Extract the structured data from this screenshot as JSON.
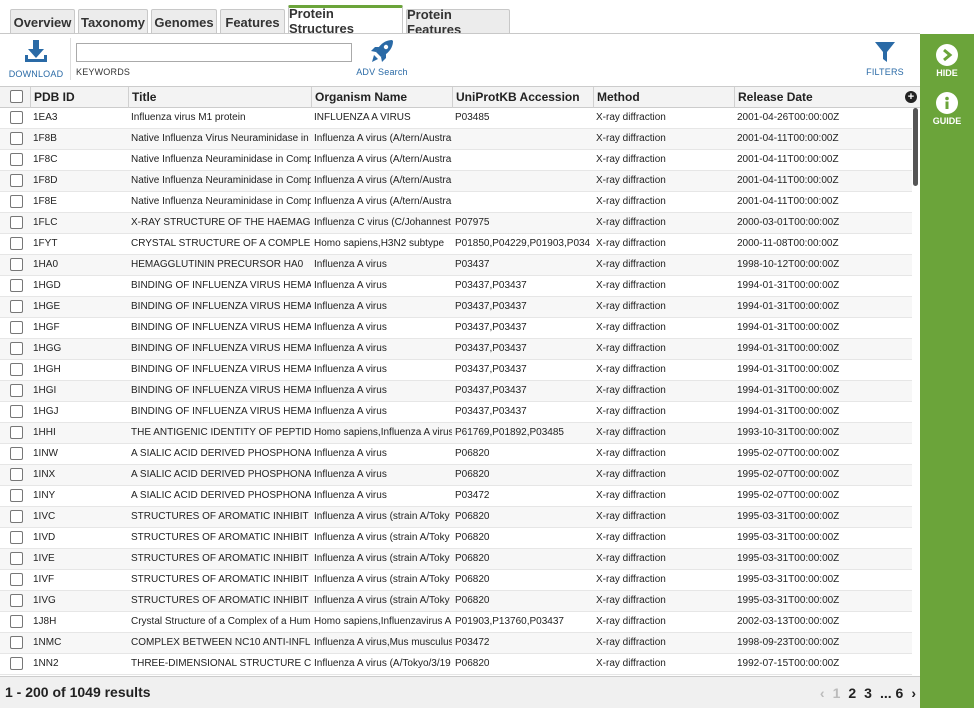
{
  "tabs": [
    "Overview",
    "Taxonomy",
    "Genomes",
    "Features",
    "Protein Structures",
    "Protein Features"
  ],
  "active_tab": "Protein Structures",
  "toolbar": {
    "download_label": "DOWNLOAD",
    "keywords_label": "KEYWORDS",
    "keywords_value": "",
    "adv_search_label": "ADV Search",
    "filters_label": "FILTERS"
  },
  "side_panel": {
    "hide_label": "HIDE",
    "guide_label": "GUIDE"
  },
  "accent_color": "#6ba43a",
  "link_color": "#2a6aa6",
  "table": {
    "columns": [
      "PDB ID",
      "Title",
      "Organism Name",
      "UniProtKB Accession",
      "Method",
      "Release Date"
    ],
    "rows": [
      [
        "1EA3",
        "Influenza virus M1 protein",
        "INFLUENZA A VIRUS",
        "P03485",
        "X-ray diffraction",
        "2001-04-26T00:00:00Z"
      ],
      [
        "1F8B",
        "Native Influenza Virus Neuraminidase in",
        "Influenza A virus (A/tern/Austra",
        "",
        "X-ray diffraction",
        "2001-04-11T00:00:00Z"
      ],
      [
        "1F8C",
        "Native Influenza Neuraminidase in Comp",
        "Influenza A virus (A/tern/Austra",
        "",
        "X-ray diffraction",
        "2001-04-11T00:00:00Z"
      ],
      [
        "1F8D",
        "Native Influenza Neuraminidase in Comp",
        "Influenza A virus (A/tern/Austra",
        "",
        "X-ray diffraction",
        "2001-04-11T00:00:00Z"
      ],
      [
        "1F8E",
        "Native Influenza Neuraminidase in Comp",
        "Influenza A virus (A/tern/Austra",
        "",
        "X-ray diffraction",
        "2001-04-11T00:00:00Z"
      ],
      [
        "1FLC",
        "X-RAY STRUCTURE OF THE HAEMAG",
        "Influenza C virus (C/Johannest",
        "P07975",
        "X-ray diffraction",
        "2000-03-01T00:00:00Z"
      ],
      [
        "1FYT",
        "CRYSTAL STRUCTURE OF A COMPLE",
        "Homo sapiens,H3N2 subtype",
        "P01850,P04229,P01903,P034",
        "X-ray diffraction",
        "2000-11-08T00:00:00Z"
      ],
      [
        "1HA0",
        "HEMAGGLUTININ PRECURSOR HA0",
        "Influenza A virus",
        "P03437",
        "X-ray diffraction",
        "1998-10-12T00:00:00Z"
      ],
      [
        "1HGD",
        "BINDING OF INFLUENZA VIRUS HEMA",
        "Influenza A virus",
        "P03437,P03437",
        "X-ray diffraction",
        "1994-01-31T00:00:00Z"
      ],
      [
        "1HGE",
        "BINDING OF INFLUENZA VIRUS HEMA",
        "Influenza A virus",
        "P03437,P03437",
        "X-ray diffraction",
        "1994-01-31T00:00:00Z"
      ],
      [
        "1HGF",
        "BINDING OF INFLUENZA VIRUS HEMA",
        "Influenza A virus",
        "P03437,P03437",
        "X-ray diffraction",
        "1994-01-31T00:00:00Z"
      ],
      [
        "1HGG",
        "BINDING OF INFLUENZA VIRUS HEMA",
        "Influenza A virus",
        "P03437,P03437",
        "X-ray diffraction",
        "1994-01-31T00:00:00Z"
      ],
      [
        "1HGH",
        "BINDING OF INFLUENZA VIRUS HEMA",
        "Influenza A virus",
        "P03437,P03437",
        "X-ray diffraction",
        "1994-01-31T00:00:00Z"
      ],
      [
        "1HGI",
        "BINDING OF INFLUENZA VIRUS HEMA",
        "Influenza A virus",
        "P03437,P03437",
        "X-ray diffraction",
        "1994-01-31T00:00:00Z"
      ],
      [
        "1HGJ",
        "BINDING OF INFLUENZA VIRUS HEMA",
        "Influenza A virus",
        "P03437,P03437",
        "X-ray diffraction",
        "1994-01-31T00:00:00Z"
      ],
      [
        "1HHI",
        "THE ANTIGENIC IDENTITY OF PEPTID",
        "Homo sapiens,Influenza A virus",
        "P61769,P01892,P03485",
        "X-ray diffraction",
        "1993-10-31T00:00:00Z"
      ],
      [
        "1INW",
        "A SIALIC ACID DERIVED PHOSPHONA",
        "Influenza A virus",
        "P06820",
        "X-ray diffraction",
        "1995-02-07T00:00:00Z"
      ],
      [
        "1INX",
        "A SIALIC ACID DERIVED PHOSPHONA",
        "Influenza A virus",
        "P06820",
        "X-ray diffraction",
        "1995-02-07T00:00:00Z"
      ],
      [
        "1INY",
        "A SIALIC ACID DERIVED PHOSPHONA",
        "Influenza A virus",
        "P03472",
        "X-ray diffraction",
        "1995-02-07T00:00:00Z"
      ],
      [
        "1IVC",
        "STRUCTURES OF AROMATIC INHIBIT",
        "Influenza A virus (strain A/Toky",
        "P06820",
        "X-ray diffraction",
        "1995-03-31T00:00:00Z"
      ],
      [
        "1IVD",
        "STRUCTURES OF AROMATIC INHIBIT",
        "Influenza A virus (strain A/Toky",
        "P06820",
        "X-ray diffraction",
        "1995-03-31T00:00:00Z"
      ],
      [
        "1IVE",
        "STRUCTURES OF AROMATIC INHIBIT",
        "Influenza A virus (strain A/Toky",
        "P06820",
        "X-ray diffraction",
        "1995-03-31T00:00:00Z"
      ],
      [
        "1IVF",
        "STRUCTURES OF AROMATIC INHIBIT",
        "Influenza A virus (strain A/Toky",
        "P06820",
        "X-ray diffraction",
        "1995-03-31T00:00:00Z"
      ],
      [
        "1IVG",
        "STRUCTURES OF AROMATIC INHIBIT",
        "Influenza A virus (strain A/Toky",
        "P06820",
        "X-ray diffraction",
        "1995-03-31T00:00:00Z"
      ],
      [
        "1J8H",
        "Crystal Structure of a Complex of a Hum",
        "Homo sapiens,Influenzavirus A",
        "P01903,P13760,P03437",
        "X-ray diffraction",
        "2002-03-13T00:00:00Z"
      ],
      [
        "1NMC",
        "COMPLEX BETWEEN NC10 ANTI-INFL",
        "Influenza A virus,Mus musculus",
        "P03472",
        "X-ray diffraction",
        "1998-09-23T00:00:00Z"
      ],
      [
        "1NN2",
        "THREE-DIMENSIONAL STRUCTURE C",
        "Influenza A virus (A/Tokyo/3/19",
        "P06820",
        "X-ray diffraction",
        "1992-07-15T00:00:00Z"
      ]
    ]
  },
  "footer": {
    "results_text": "1 - 200 of 1049 results",
    "pager": {
      "prev": "‹",
      "page1": "1",
      "page2": "2",
      "page3": "3",
      "ellipsis_last": "... 6",
      "next": "›"
    }
  }
}
